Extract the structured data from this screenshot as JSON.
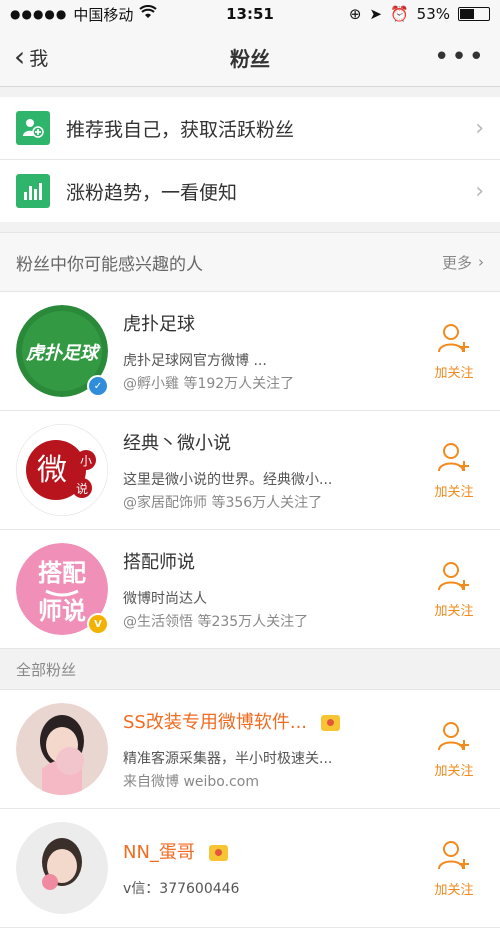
{
  "status_bar": {
    "carrier": "中国移动",
    "time": "13:51",
    "battery": "53%",
    "battery_level": 0.53
  },
  "navbar": {
    "back_label": "我",
    "title": "粉丝"
  },
  "menu": [
    {
      "label": "推荐我自己，获取活跃粉丝",
      "icon": "add-user-icon"
    },
    {
      "label": "涨粉趋势，一看便知",
      "icon": "bar-chart-icon"
    }
  ],
  "interest_section": {
    "title": "粉丝中你可能感兴趣的人",
    "more": "更多"
  },
  "suggested_users": [
    {
      "name": "虎扑足球",
      "desc": "虎扑足球网官方微博 ...",
      "sub": "@孵小雞 等192万人关注了",
      "avatar_text": "虎扑足球",
      "verify_color": "#2f8ddc",
      "follow_label": "加关注"
    },
    {
      "name": "经典丶微小说",
      "desc": "这里是微小说的世界。经典微小...",
      "sub": "@家居配饰师 等356万人关注了",
      "avatar_text": "微小说",
      "follow_label": "加关注"
    },
    {
      "name": "搭配师说",
      "desc": "微博时尚达人",
      "sub": "@生活领悟 等235万人关注了",
      "avatar_text": "搭配师说",
      "verify_color": "#f4b200",
      "follow_label": "加关注"
    }
  ],
  "all_fans": {
    "title": "全部粉丝",
    "items": [
      {
        "name": "SS改装专用微博软件...",
        "desc": "精准客源采集器，半小时极速关...",
        "sub": "来自微博 weibo.com",
        "follow_label": "加关注"
      },
      {
        "name": "NN_蛋哥",
        "desc": "v信：377600446",
        "follow_label": "加关注"
      }
    ]
  },
  "colors": {
    "accent_orange": "#f28a1d",
    "name_orange": "#f26b21",
    "menu_icon_green": "#2fb46c"
  }
}
